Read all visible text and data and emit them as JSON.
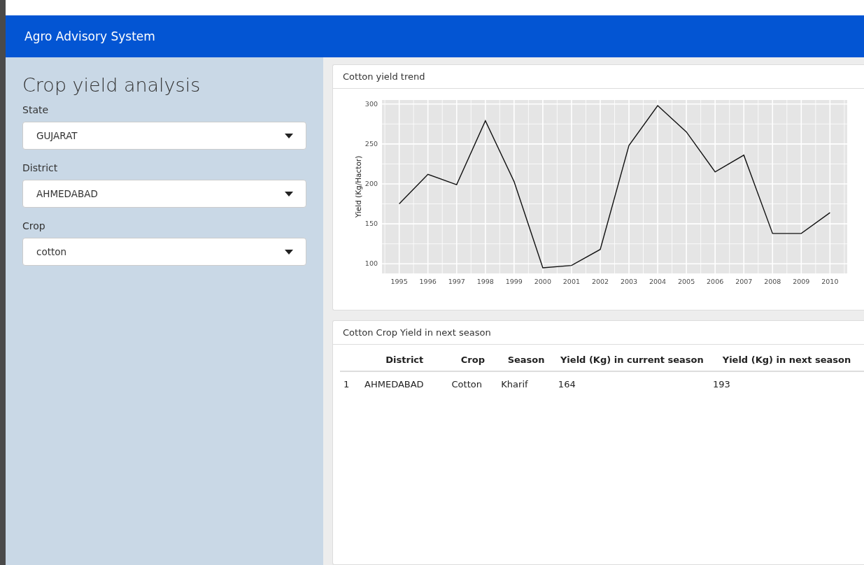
{
  "navbar": {
    "title": "Agro Advisory System"
  },
  "sidebar": {
    "heading": "Crop yield analysis",
    "inputs": [
      {
        "label": "State",
        "value": "GUJARAT"
      },
      {
        "label": "District",
        "value": "AHMEDABAD"
      },
      {
        "label": "Crop",
        "value": "cotton"
      }
    ]
  },
  "chart_panel": {
    "title": "Cotton yield trend",
    "chart_data": {
      "type": "line",
      "ylabel": "Yield (Kg/Hactor)",
      "categories": [
        "1995",
        "1996",
        "1997",
        "1998",
        "1999",
        "2000",
        "2001",
        "2002",
        "2003",
        "2004",
        "2005",
        "2006",
        "2007",
        "2008",
        "2009",
        "2010"
      ],
      "values": [
        175,
        212,
        199,
        279,
        203,
        95,
        98,
        118,
        248,
        298,
        265,
        215,
        236,
        138,
        138,
        164
      ],
      "ylim": [
        88,
        305
      ],
      "yticks": [
        100,
        150,
        200,
        250,
        300
      ],
      "grid": true
    }
  },
  "table_panel": {
    "title": "Cotton Crop Yield in next season",
    "columns": [
      "",
      "District",
      "Crop",
      "Season",
      "Yield (Kg) in current season",
      "Yield (Kg) in next season"
    ],
    "rows": [
      [
        "1",
        "AHMEDABAD",
        "Cotton",
        "Kharif",
        "164",
        "193"
      ]
    ]
  }
}
